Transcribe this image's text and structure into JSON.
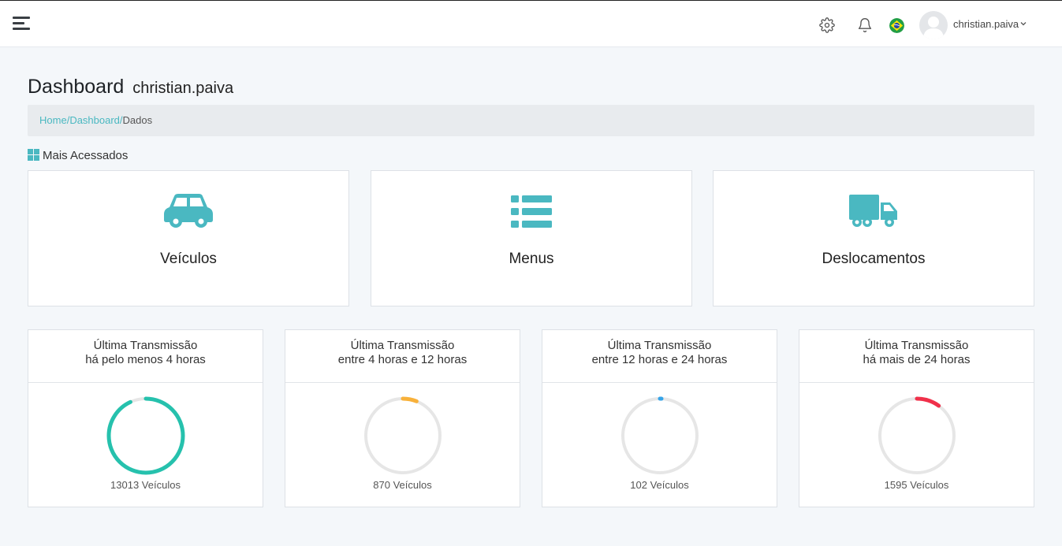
{
  "header": {
    "user_name": "christian.paiva",
    "language_flag": "brazil-flag-icon"
  },
  "page": {
    "title": "Dashboard",
    "subtitle": "christian.paiva"
  },
  "breadcrumb": {
    "items": [
      "Home",
      "Dashboard"
    ],
    "separator": "/",
    "current": "Dados"
  },
  "section": {
    "title": "Mais Acessados"
  },
  "cards": [
    {
      "label": "Veículos",
      "icon": "car-icon"
    },
    {
      "label": "Menus",
      "icon": "list-icon"
    },
    {
      "label": "Deslocamentos",
      "icon": "truck-icon"
    }
  ],
  "stats": [
    {
      "title_line1": "Última Transmissão",
      "title_line2": "há pelo menos 4 horas",
      "value": "13013 Veículos",
      "fraction": 0.93,
      "color": "#26c1ad"
    },
    {
      "title_line1": "Última Transmissão",
      "title_line2": "entre 4 horas e 12 horas",
      "value": "870 Veículos",
      "fraction": 0.06,
      "color": "#f8b13a"
    },
    {
      "title_line1": "Última Transmissão",
      "title_line2": "entre 12 horas e 24 horas",
      "value": "102 Veículos",
      "fraction": 0.007,
      "color": "#35a4e8"
    },
    {
      "title_line1": "Última Transmissão",
      "title_line2": "há mais de 24 horas",
      "value": "1595 Veículos",
      "fraction": 0.1,
      "color": "#f0304a"
    }
  ],
  "colors": {
    "accent": "#4ab8c1",
    "ring_track": "#e6e6e6"
  }
}
